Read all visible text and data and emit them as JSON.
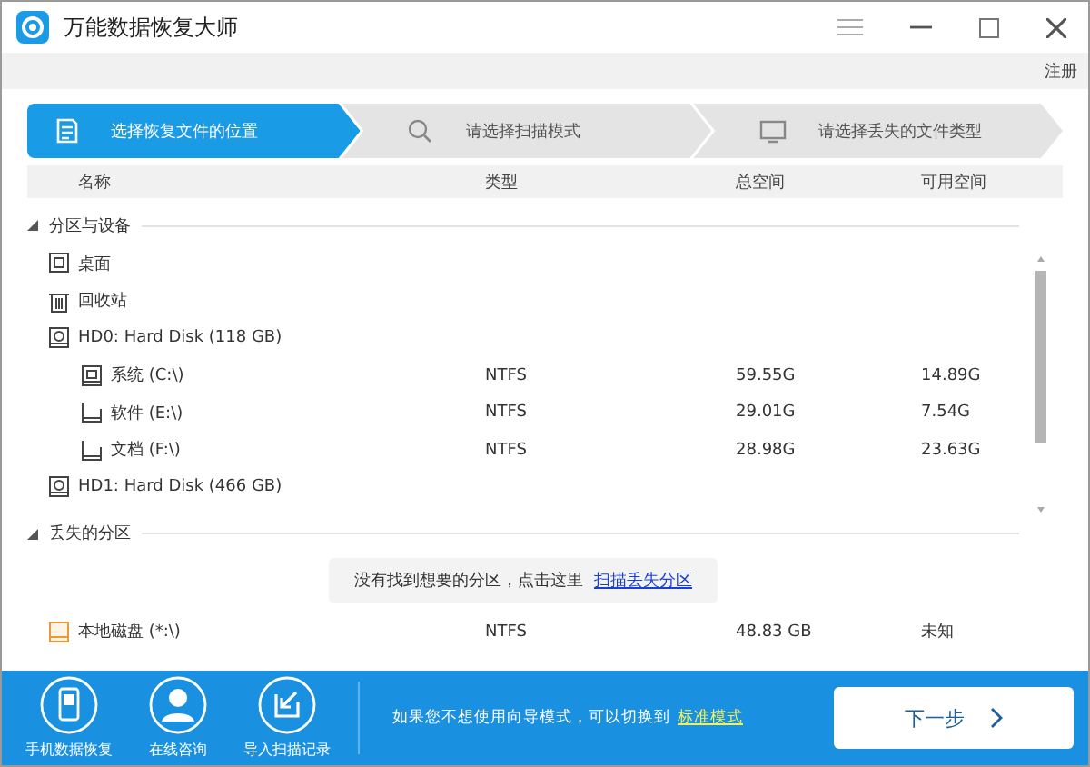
{
  "window": {
    "title": "万能数据恢复大师"
  },
  "register_link": "注册",
  "steps": [
    {
      "label": "选择恢复文件的位置",
      "selected": true,
      "kind": "doc"
    },
    {
      "label": "请选择扫描模式",
      "selected": false,
      "kind": "search"
    },
    {
      "label": "请选择丢失的文件类型",
      "selected": false,
      "kind": "monitor"
    }
  ],
  "table": {
    "columns": [
      "名称",
      "类型",
      "总空间",
      "可用空间"
    ],
    "sections": [
      {
        "title": "分区与设备",
        "expanded": true,
        "items": [
          {
            "name": "桌面",
            "kind": "desktop"
          },
          {
            "name": "回收站",
            "kind": "bin"
          },
          {
            "name": "HD0: Hard Disk (118 GB)",
            "kind": "disk",
            "children": [
              {
                "name": "系统 (C:\\)",
                "kind": "system",
                "type": "NTFS",
                "total": "59.55G",
                "free": "14.89G"
              },
              {
                "name": "软件 (E:\\)",
                "kind": "drive",
                "type": "NTFS",
                "total": "29.01G",
                "free": "7.54G"
              },
              {
                "name": "文档 (F:\\)",
                "kind": "drive",
                "type": "NTFS",
                "total": "28.98G",
                "free": "23.63G"
              }
            ]
          },
          {
            "name": "HD1: Hard Disk (466 GB)",
            "kind": "disk"
          }
        ]
      },
      {
        "title": "丢失的分区",
        "expanded": true,
        "notice": {
          "text": "没有找到想要的分区，点击这里",
          "link": "扫描丢失分区"
        },
        "items": [
          {
            "name": "本地磁盘 (*:\\)",
            "kind": "lost",
            "type": "NTFS",
            "total": "48.83 GB",
            "free": "未知"
          }
        ]
      }
    ]
  },
  "footer": {
    "tools": [
      {
        "label": "手机数据恢复",
        "kind": "phone"
      },
      {
        "label": "在线咨询",
        "kind": "person"
      },
      {
        "label": "导入扫描记录",
        "kind": "import"
      }
    ],
    "hint": "如果您不想使用向导模式，可以切换到",
    "hint_link": "标准模式",
    "next": "下一步"
  }
}
